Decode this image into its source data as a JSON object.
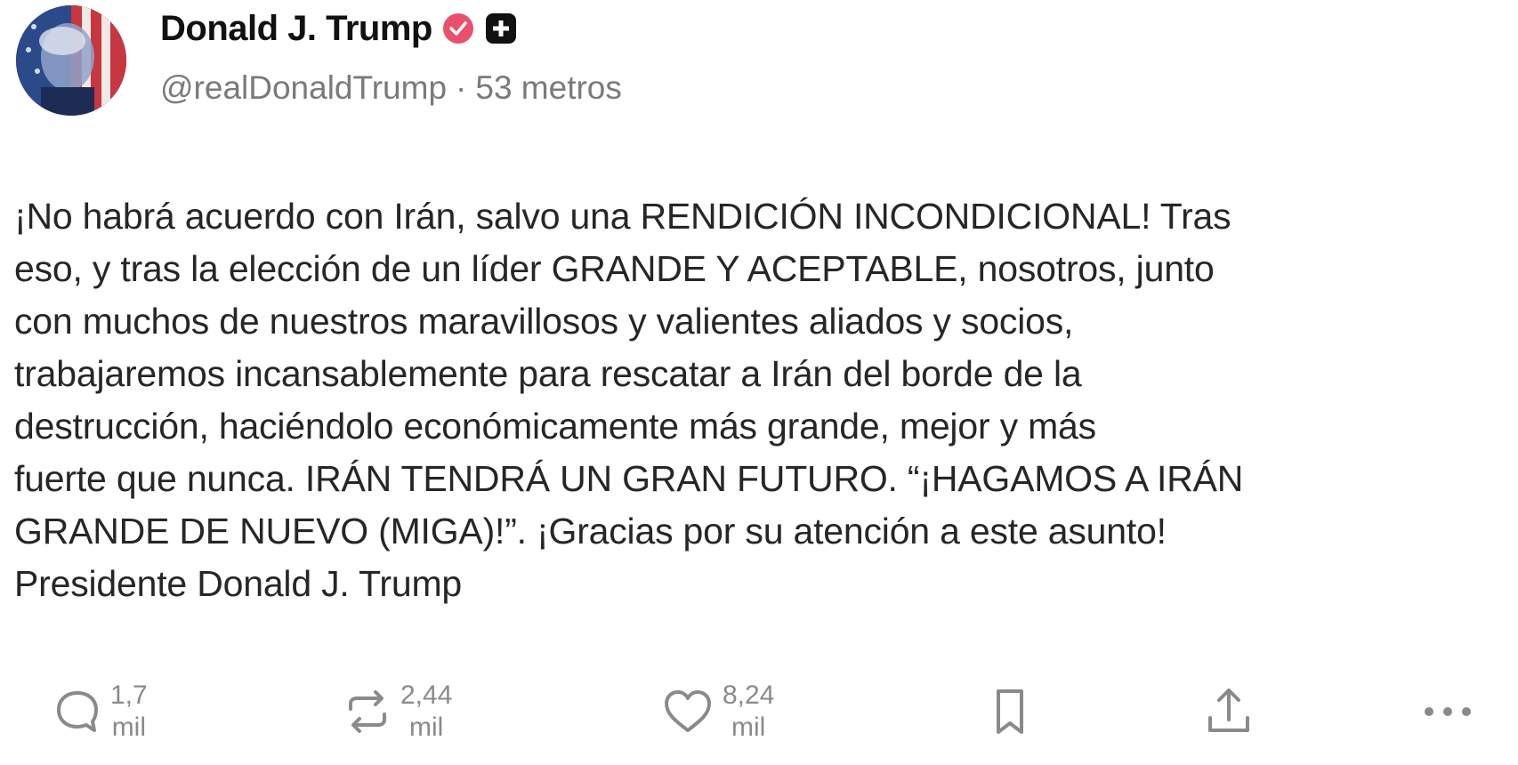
{
  "author": {
    "display_name": "Donald J. Trump",
    "handle": "@realDonaldTrump",
    "separator": "·",
    "time_ago": "53 metros",
    "avatar_icon": "avatar-portrait",
    "badges": [
      "verified-badge-icon",
      "plus-badge-icon"
    ]
  },
  "post": {
    "text": "¡No habrá acuerdo con Irán, salvo una RENDICIÓN INCONDICIONAL! Tras\neso, y tras la elección de un líder GRANDE Y ACEPTABLE, nosotros, junto\ncon muchos de nuestros maravillosos y valientes aliados y socios,\ntrabajaremos incansablemente para rescatar a Irán del borde de la\ndestrucción, haciéndolo económicamente más grande, mejor y más\nfuerte que nunca. IRÁN TENDRÁ UN GRAN FUTURO. “¡HAGAMOS A IRÁN\nGRANDE DE NUEVO (MIGA)!”. ¡Gracias por su atención a este asunto!\nPresidente Donald J. Trump"
  },
  "actions": {
    "reply": {
      "icon": "reply-icon",
      "count_top": "1,7",
      "count_bottom": "mil"
    },
    "repost": {
      "icon": "repost-icon",
      "count_top": "2,44",
      "count_bottom": "mil"
    },
    "like": {
      "icon": "heart-icon",
      "count_top": "8,24",
      "count_bottom": "mil"
    },
    "bookmark": {
      "icon": "bookmark-icon"
    },
    "share": {
      "icon": "share-icon"
    },
    "more": {
      "icon": "more-icon"
    }
  },
  "colors": {
    "verified_badge": "#e8506e",
    "text": "#262626",
    "muted": "#7a7a7a",
    "icon": "#8a8a8a"
  }
}
